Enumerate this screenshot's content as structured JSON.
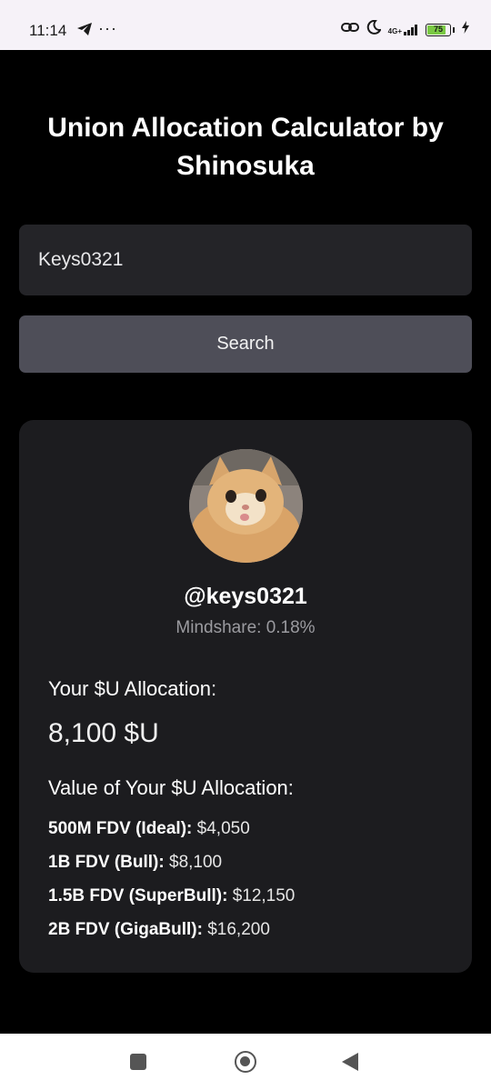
{
  "status_bar": {
    "time": "11:14",
    "dots": "···",
    "network": "4G+",
    "battery_level": "75",
    "battery_color": "#7ac943"
  },
  "app": {
    "title": "Union Allocation Calculator by Shinosuka"
  },
  "search": {
    "value": "Keys0321",
    "button_label": "Search"
  },
  "profile": {
    "handle": "@keys0321",
    "mindshare": "Mindshare: 0.18%",
    "allocation_label": "Your $U Allocation:",
    "allocation_value": "8,100 $U",
    "value_heading": "Value of Your $U Allocation:",
    "valuations": [
      {
        "label": "500M FDV (Ideal):",
        "value": "$4,050"
      },
      {
        "label": "1B FDV (Bull):",
        "value": "$8,100"
      },
      {
        "label": "1.5B FDV (SuperBull):",
        "value": "$12,150"
      },
      {
        "label": "2B FDV (GigaBull):",
        "value": "$16,200"
      }
    ]
  },
  "colors": {
    "background": "#000000",
    "card": "#1c1c1f",
    "input": "#242428",
    "button": "#4e4e58",
    "muted_text": "#9b9ba0"
  }
}
